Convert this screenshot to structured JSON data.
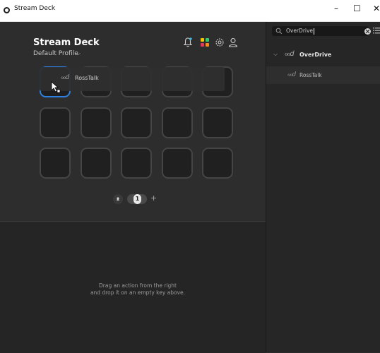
{
  "window": {
    "title": "Stream Deck",
    "minimize": "–",
    "maximize": "☐",
    "close": "✕"
  },
  "header": {
    "device_name": "Stream Deck",
    "device_chevron": "⌵",
    "profile_name": "Default Profile",
    "profile_chevron": "⌵"
  },
  "drag": {
    "icon": "ℴℴd",
    "label": "RossTalk"
  },
  "pager": {
    "current_page": "1",
    "add": "+"
  },
  "hint": {
    "line1": "Drag an action from the right",
    "line2": "and drop it on an empty key above."
  },
  "sidebar": {
    "search_value": "OverDrive",
    "category": {
      "chevron": "⌵",
      "logo": "ℴℴd",
      "label": "OverDrive"
    },
    "action": {
      "logo": "ℴℴd",
      "label": "RossTalk"
    }
  },
  "colors": {
    "selected_key_border": "#2d7fe0",
    "panel_bg": "#2d2d2d",
    "sidebar_bg": "#262626"
  }
}
